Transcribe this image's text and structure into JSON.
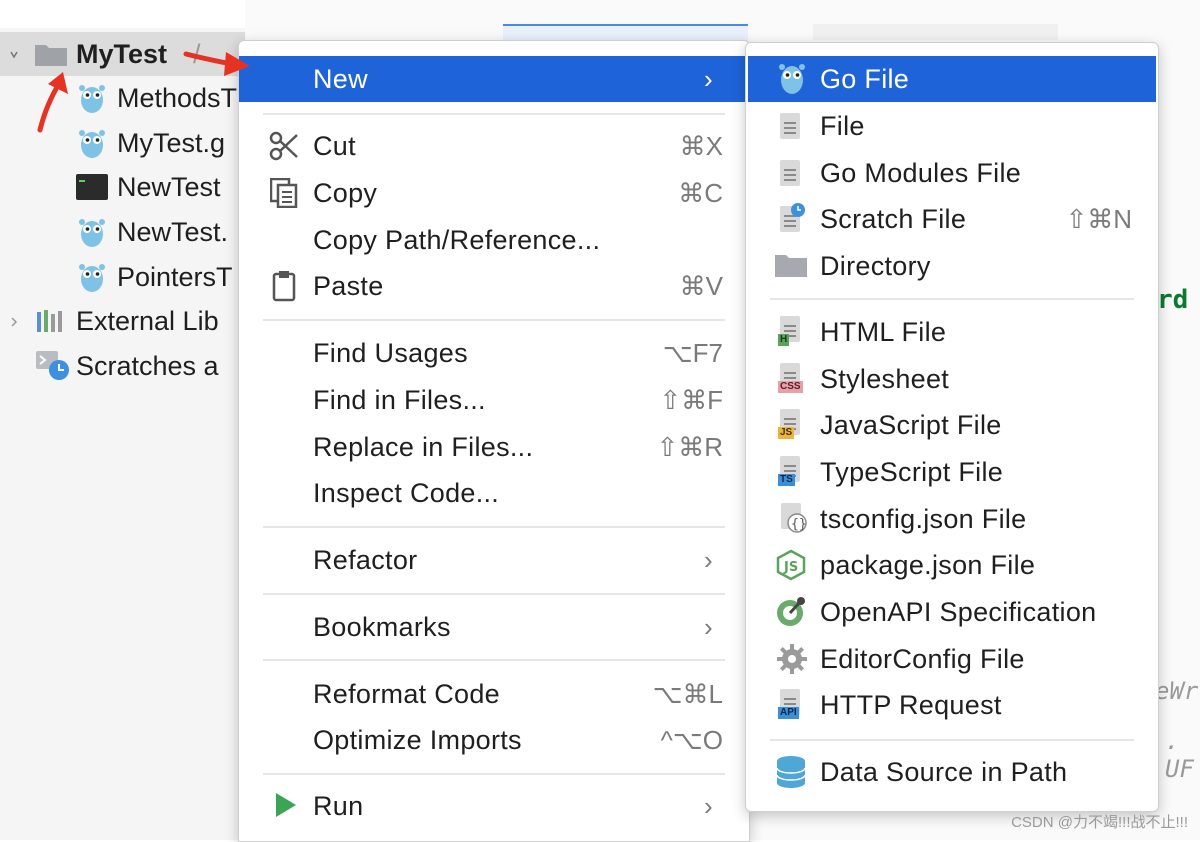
{
  "tree": {
    "root": "MyTest",
    "root_suffix": "/",
    "items": [
      {
        "label": "MethodsT",
        "icon": "gopher-icon"
      },
      {
        "label": "MyTest.g",
        "icon": "gopher-icon"
      },
      {
        "label": "NewTest",
        "icon": "terminal-icon"
      },
      {
        "label": "NewTest.",
        "icon": "gopher-icon"
      },
      {
        "label": "PointersT",
        "icon": "gopher-icon"
      }
    ],
    "external": "External Lib",
    "scratches": "Scratches a"
  },
  "editor": {
    "fragment_1": "rd",
    "fragment_2": "eWr",
    "fragment_3": ". UF"
  },
  "main_menu": [
    {
      "label": "New",
      "shortcut": "",
      "submenu": true,
      "highlighted": true,
      "icon": ""
    },
    {
      "label": "Cut",
      "shortcut": "⌘X",
      "icon": "scissors-icon"
    },
    {
      "label": "Copy",
      "shortcut": "⌘C",
      "icon": "copy-icon"
    },
    {
      "label": "Copy Path/Reference...",
      "shortcut": "",
      "icon": ""
    },
    {
      "label": "Paste",
      "shortcut": "⌘V",
      "icon": "clipboard-icon"
    },
    {
      "label": "Find Usages",
      "shortcut": "⌥F7",
      "icon": ""
    },
    {
      "label": "Find in Files...",
      "shortcut": "⇧⌘F",
      "icon": ""
    },
    {
      "label": "Replace in Files...",
      "shortcut": "⇧⌘R",
      "icon": ""
    },
    {
      "label": "Inspect Code...",
      "shortcut": "",
      "icon": ""
    },
    {
      "label": "Refactor",
      "shortcut": "",
      "submenu": true,
      "icon": ""
    },
    {
      "label": "Bookmarks",
      "shortcut": "",
      "submenu": true,
      "icon": ""
    },
    {
      "label": "Reformat Code",
      "shortcut": "⌥⌘L",
      "icon": ""
    },
    {
      "label": "Optimize Imports",
      "shortcut": "^⌥O",
      "icon": ""
    },
    {
      "label": "Run",
      "shortcut": "",
      "submenu": true,
      "icon": "run-icon"
    }
  ],
  "sub_menu": [
    {
      "label": "Go File",
      "shortcut": "",
      "highlighted": true,
      "icon": "gopher-icon"
    },
    {
      "label": "File",
      "shortcut": "",
      "icon": "file-icon"
    },
    {
      "label": "Go Modules File",
      "shortcut": "",
      "icon": "file-icon"
    },
    {
      "label": "Scratch File",
      "shortcut": "⇧⌘N",
      "icon": "scratch-file-icon"
    },
    {
      "label": "Directory",
      "shortcut": "",
      "icon": "folder-icon"
    },
    {
      "label": "HTML File",
      "shortcut": "",
      "icon": "html-file-icon",
      "badge": "H"
    },
    {
      "label": "Stylesheet",
      "shortcut": "",
      "icon": "css-file-icon",
      "badge": "CSS"
    },
    {
      "label": "JavaScript File",
      "shortcut": "",
      "icon": "js-file-icon",
      "badge": "JS"
    },
    {
      "label": "TypeScript File",
      "shortcut": "",
      "icon": "ts-file-icon",
      "badge": "TS"
    },
    {
      "label": "tsconfig.json File",
      "shortcut": "",
      "icon": "json-file-icon"
    },
    {
      "label": "package.json File",
      "shortcut": "",
      "icon": "nodejs-icon"
    },
    {
      "label": "OpenAPI Specification",
      "shortcut": "",
      "icon": "openapi-icon"
    },
    {
      "label": "EditorConfig File",
      "shortcut": "",
      "icon": "gear-icon"
    },
    {
      "label": "HTTP Request",
      "shortcut": "",
      "icon": "api-file-icon",
      "badge": "API"
    },
    {
      "label": "Data Source in Path",
      "shortcut": "",
      "icon": "database-icon"
    }
  ],
  "colors": {
    "highlight": "#1f63d8",
    "arrow": "#e53222",
    "html_badge": "#5aa35a",
    "css_badge": "#e8a0a8",
    "js_badge": "#e9b53a",
    "ts_badge": "#3a8fd6",
    "api_badge": "#3a8fd6",
    "gopher": "#7ec3e6"
  },
  "watermark": "CSDN @力不竭!!!战不止!!!"
}
